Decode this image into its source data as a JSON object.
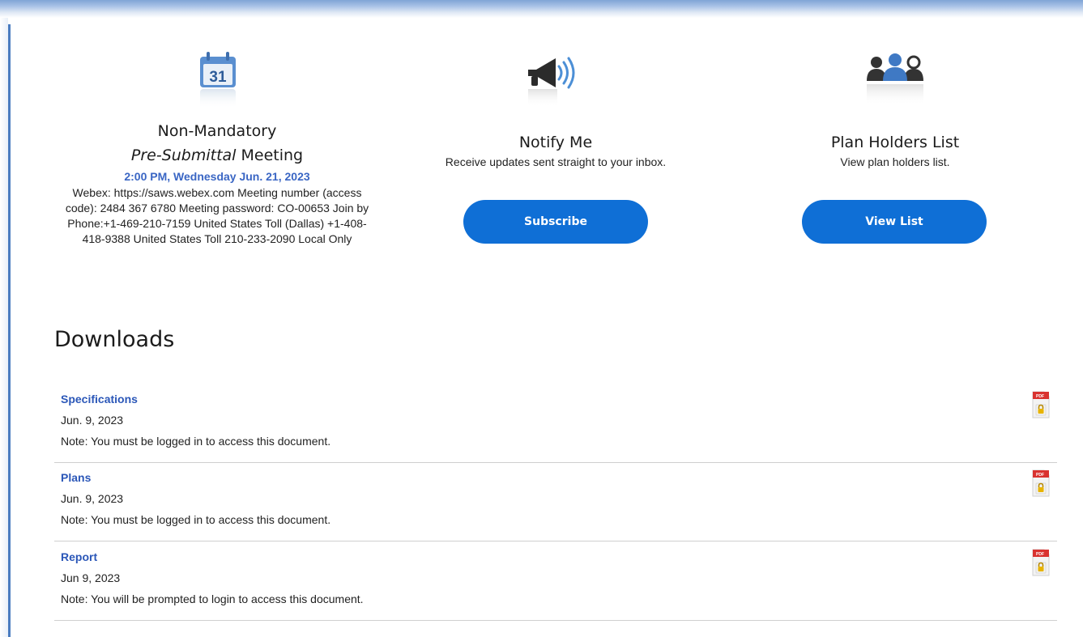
{
  "meeting": {
    "title_line1": "Non-Mandatory",
    "title_italic": "Pre-Submittal",
    "title_rest": " Meeting",
    "time": "2:00 PM, Wednesday Jun. 21, 2023",
    "details": "Webex: https://saws.webex.com Meeting number (access code): 2484 367 6780 Meeting password: CO-00653 Join by Phone:+1-469-210-7159 United States Toll (Dallas) +1-408-418-9388 United States Toll 210-233-2090 Local Only",
    "calendar_day": "31",
    "icon": "calendar-icon"
  },
  "notify": {
    "title": "Notify Me",
    "subtitle": "Receive updates sent straight to your inbox.",
    "button_label": "Subscribe",
    "icon": "megaphone-icon"
  },
  "plan_holders": {
    "title": "Plan Holders List",
    "subtitle": "View plan holders list.",
    "button_label": "View List",
    "icon": "people-icon"
  },
  "downloads": {
    "heading": "Downloads",
    "items": [
      {
        "name": "Specifications",
        "date": "Jun. 9, 2023",
        "note": "Note: You must be logged in to access this document.",
        "icon": "locked-pdf-icon"
      },
      {
        "name": "Plans",
        "date": "Jun. 9, 2023",
        "note": "Note: You must be logged in to access this document.",
        "icon": "locked-pdf-icon"
      },
      {
        "name": "Report",
        "date": "Jun 9, 2023",
        "note": "Note: You will be prompted to login to access this document.",
        "icon": "locked-pdf-icon"
      }
    ],
    "pdf_badge": "PDF"
  },
  "colors": {
    "accent_button": "#0f6fd6",
    "link": "#2b57b8",
    "time_text": "#3a66c4",
    "icon_blue": "#5a8fd0"
  }
}
